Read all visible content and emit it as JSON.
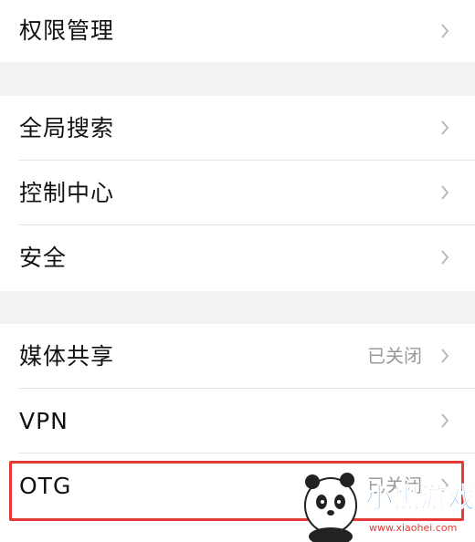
{
  "colors": {
    "background": "#f2f2f2",
    "row": "#ffffff",
    "text": "#111111",
    "secondary": "#9a9a9a",
    "highlight": "#e53935"
  },
  "groups": [
    {
      "items": [
        {
          "label": "权限管理",
          "value": ""
        }
      ]
    },
    {
      "items": [
        {
          "label": "全局搜索",
          "value": ""
        },
        {
          "label": "控制中心",
          "value": ""
        },
        {
          "label": "安全",
          "value": ""
        }
      ]
    },
    {
      "items": [
        {
          "label": "媒体共享",
          "value": "已关闭"
        },
        {
          "label": "VPN",
          "value": ""
        },
        {
          "label": "OTG",
          "value": "已关闭"
        }
      ]
    }
  ],
  "watermark": {
    "title": "小黑游戏",
    "url": "www.xiaohei.com"
  },
  "icons": {
    "chevron": "chevron-right-icon"
  }
}
